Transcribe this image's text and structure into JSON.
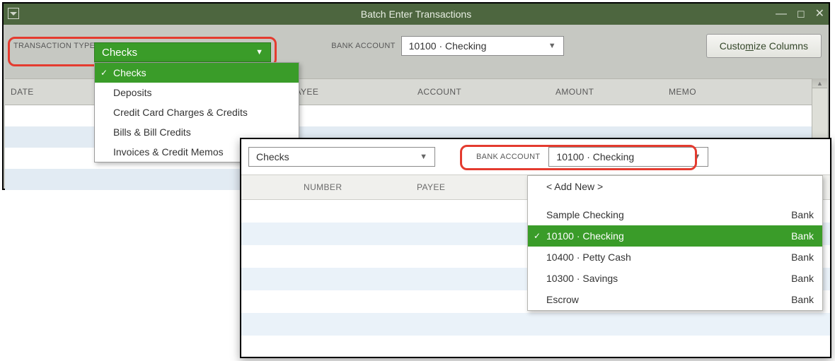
{
  "window": {
    "title": "Batch Enter Transactions"
  },
  "toolbar": {
    "trans_type_label": "TRANSACTION TYPE",
    "trans_type_value": "Checks",
    "bank_account_label": "BANK ACCOUNT",
    "bank_account_value": "10100 · Checking",
    "customize_btn_prefix": "Custo",
    "customize_btn_hotkey": "m",
    "customize_btn_suffix": "ize Columns"
  },
  "trans_type_menu": [
    {
      "label": "Checks",
      "selected": true
    },
    {
      "label": "Deposits",
      "selected": false
    },
    {
      "label": "Credit Card Charges & Credits",
      "selected": false
    },
    {
      "label": "Bills & Bill Credits",
      "selected": false
    },
    {
      "label": "Invoices & Credit Memos",
      "selected": false
    }
  ],
  "columns_a": {
    "date": "DATE",
    "payee": "PAYEE",
    "account": "ACCOUNT",
    "amount": "AMOUNT",
    "memo": "MEMO"
  },
  "columns_b": {
    "number": "NUMBER",
    "payee": "PAYEE"
  },
  "bank_menu": {
    "add_new": "< Add New >",
    "items": [
      {
        "name": "Sample Checking",
        "type": "Bank",
        "selected": false
      },
      {
        "name": "10100 · Checking",
        "type": "Bank",
        "selected": true
      },
      {
        "name": "10400 · Petty Cash",
        "type": "Bank",
        "selected": false
      },
      {
        "name": "10300 · Savings",
        "type": "Bank",
        "selected": false
      },
      {
        "name": "Escrow",
        "type": "Bank",
        "selected": false
      }
    ]
  },
  "overlay_b": {
    "trans_type_value": "Checks",
    "bank_account_label": "BANK ACCOUNT",
    "bank_account_value": "10100 · Checking"
  }
}
